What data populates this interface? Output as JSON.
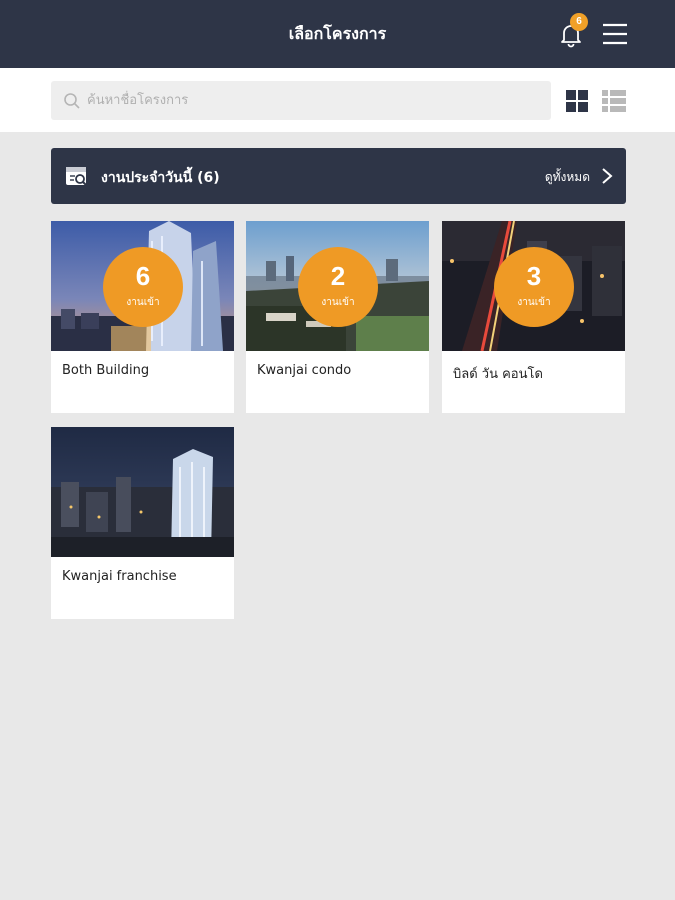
{
  "header": {
    "title": "เลือกโครงการ",
    "notification_count": "6"
  },
  "search": {
    "placeholder": "ค้นหาชื่อโครงการ"
  },
  "today_tasks": {
    "label": "งานประจำวันนี้ (6)",
    "view_all": "ดูทั้งหมด"
  },
  "projects": [
    {
      "name": "Both Building",
      "count": "6",
      "count_label": "งานเข้า"
    },
    {
      "name": "Kwanjai condo",
      "count": "2",
      "count_label": "งานเข้า"
    },
    {
      "name": "บิลด์ วัน คอนโด",
      "count": "3",
      "count_label": "งานเข้า"
    },
    {
      "name": "Kwanjai franchise"
    }
  ],
  "colors": {
    "header_bg": "#2e3547",
    "badge": "#ef9a25",
    "background": "#e8e8e8"
  }
}
